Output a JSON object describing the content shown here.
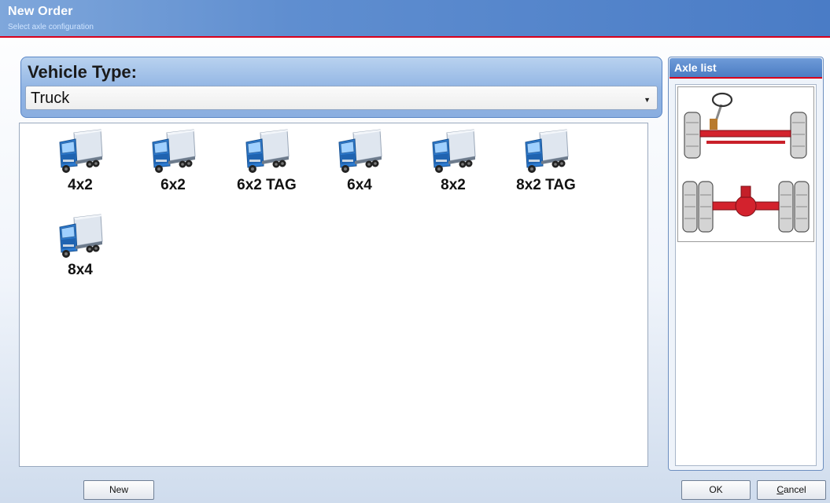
{
  "window": {
    "title": "New Order",
    "subtitle": "Select axle configuration"
  },
  "vehicle_type": {
    "label": "Vehicle Type:",
    "selected": "Truck"
  },
  "vehicles": [
    {
      "label": "4x2"
    },
    {
      "label": "6x2"
    },
    {
      "label": "6x2 TAG"
    },
    {
      "label": "6x4"
    },
    {
      "label": "8x2"
    },
    {
      "label": "8x2 TAG"
    },
    {
      "label": "8x4"
    }
  ],
  "axle_list": {
    "title": "Axle list"
  },
  "buttons": {
    "new": "New",
    "ok": "OK",
    "cancel_mnemonic": "C",
    "cancel_rest": "ancel"
  },
  "colors": {
    "accent_red": "#d9001b",
    "header_blue": "#4a7cc6",
    "truck_blue": "#2d7bd0"
  },
  "icons": {
    "vehicle": "truck-icon",
    "axle_front": "steering-axle-icon",
    "axle_rear": "drive-axle-icon"
  }
}
